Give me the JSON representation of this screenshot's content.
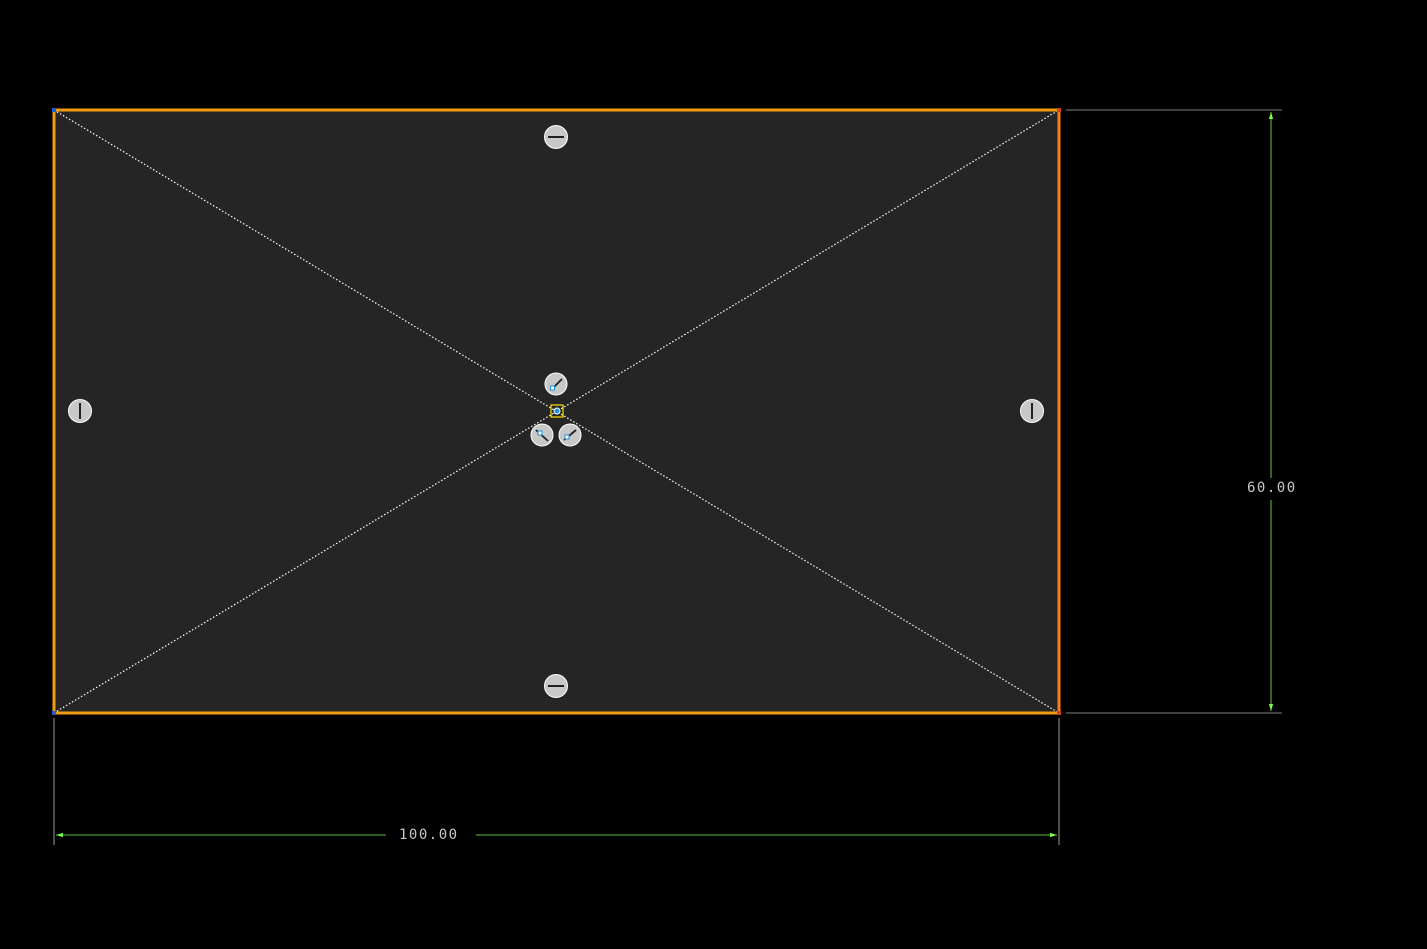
{
  "sketch": {
    "dimensions": {
      "horizontal": "100.00",
      "vertical": "60.00"
    },
    "colors": {
      "background": "#000000",
      "region_fill": "#252525",
      "rectangle_edge": "#f39c12",
      "rectangle_edge_right": "#ff7a1a",
      "construction_line": "#ffffff",
      "dimension_line": "#7cff4a",
      "dimension_text": "#c8c8c8",
      "constraint_badge_fill": "#c8c8c8",
      "vertex_point": "#1f5fd6",
      "center_point": "#ffe000"
    },
    "constraints": [
      {
        "name": "horizontal-constraint-icon",
        "kind": "horizontal"
      },
      {
        "name": "horizontal-constraint-icon",
        "kind": "horizontal"
      },
      {
        "name": "vertical-constraint-icon",
        "kind": "vertical"
      },
      {
        "name": "vertical-constraint-icon",
        "kind": "vertical"
      },
      {
        "name": "midpoint-constraint-icon",
        "kind": "midpoint"
      }
    ]
  }
}
